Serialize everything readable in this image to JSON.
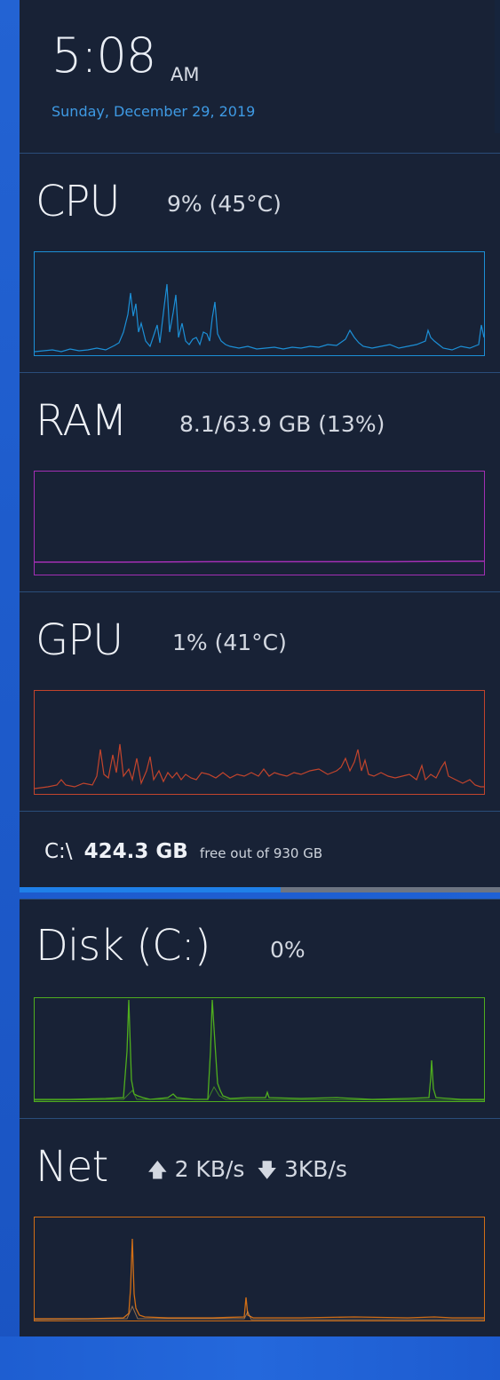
{
  "clock": {
    "time": "5:08",
    "ampm": "AM",
    "date": "Sunday, December 29, 2019"
  },
  "cpu": {
    "label": "CPU",
    "value": "9% (45°C)",
    "color": "#1c8fd6"
  },
  "ram": {
    "label": "RAM",
    "value": "8.1/63.9 GB (13%)",
    "color": "#a22fb4"
  },
  "gpu": {
    "label": "GPU",
    "value": "1% (41°C)",
    "color": "#c2442c"
  },
  "drive": {
    "letter": "C:\\",
    "free": "424.3 GB",
    "suffix": "free out of 930 GB",
    "used_fraction": 0.544,
    "bar_color": "#1f80e8"
  },
  "disk": {
    "label": "Disk (C:)",
    "value": "0%",
    "color": "#4fae1e"
  },
  "net": {
    "label": "Net",
    "up_icon": "arrow-up-icon",
    "up_value": "2 KB/s",
    "down_icon": "arrow-down-icon",
    "down_value": "3KB/s",
    "color": "#d16e16"
  }
}
